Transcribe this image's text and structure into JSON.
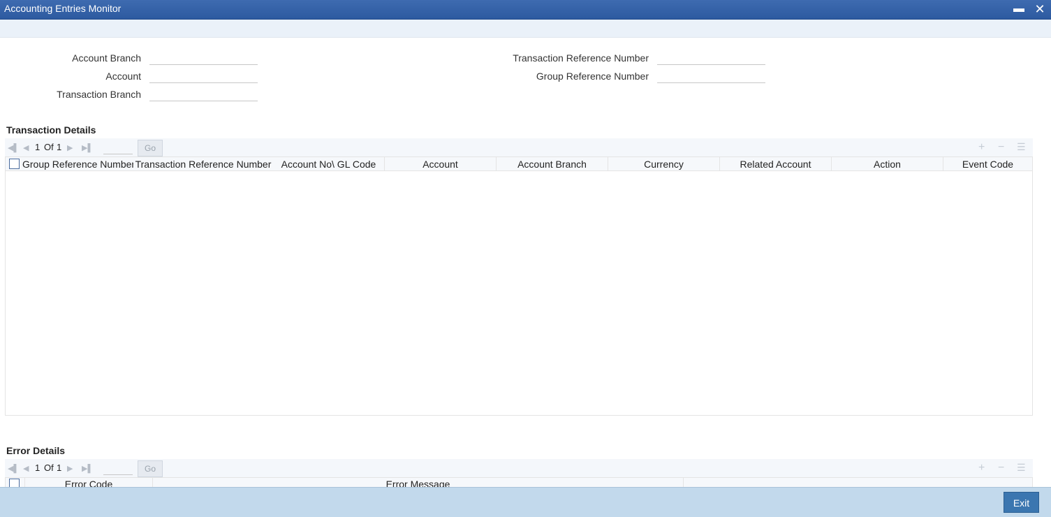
{
  "window": {
    "title": "Accounting Entries Monitor",
    "minimize_glyph": "▬",
    "close_glyph": "✕"
  },
  "form": {
    "account_branch_label": "Account Branch",
    "account_label": "Account",
    "transaction_branch_label": "Transaction Branch",
    "transaction_reference_label": "Transaction Reference Number",
    "group_reference_label": "Group Reference Number",
    "account_branch_value": "",
    "account_value": "",
    "transaction_branch_value": "",
    "transaction_reference_value": "",
    "group_reference_value": ""
  },
  "transaction_details": {
    "title": "Transaction Details",
    "pager": {
      "current": "1",
      "of_label": "Of",
      "total": "1",
      "go_label": "Go",
      "page_input": ""
    },
    "columns": [
      "Group Reference Number",
      "Transaction Reference Number",
      "Account No\\ GL Code",
      "Account",
      "Account Branch",
      "Currency",
      "Related Account",
      "Action",
      "Event Code"
    ],
    "rows": []
  },
  "error_details": {
    "title": "Error Details",
    "pager": {
      "current": "1",
      "of_label": "Of",
      "total": "1",
      "go_label": "Go",
      "page_input": ""
    },
    "columns": [
      "Error Code",
      "Error Message"
    ],
    "rows": []
  },
  "footer": {
    "exit_label": "Exit"
  },
  "icons": {
    "first": "first-page-icon",
    "prev": "previous-page-icon",
    "next": "next-page-icon",
    "last": "last-page-icon",
    "add": "add-row-icon",
    "delete": "delete-row-icon",
    "single_view": "single-record-view-icon"
  },
  "colors": {
    "titlebar": "#2d5aa0",
    "footer": "#c2d9ec",
    "exit_button": "#3b76b0"
  }
}
